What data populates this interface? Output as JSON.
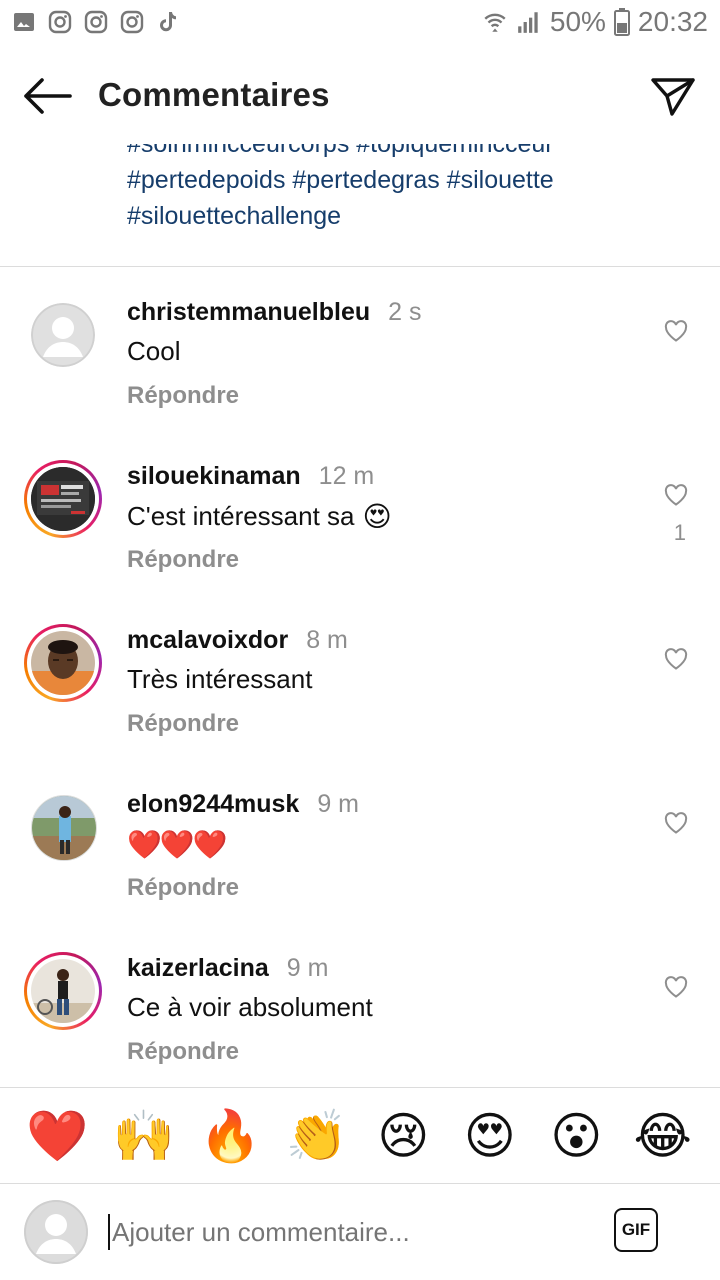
{
  "status_bar": {
    "battery": "50%",
    "time": "20:32",
    "left_icons": [
      "gallery-icon",
      "instagram-icon",
      "instagram-icon",
      "instagram-icon",
      "tiktok-icon"
    ],
    "right_icons": [
      "wifi-icon",
      "signal-icon",
      "battery-icon"
    ]
  },
  "header": {
    "title": "Commentaires",
    "back_icon": "back-arrow-icon",
    "share_icon": "send-icon"
  },
  "caption": {
    "line0": "#soinmincceurcorps #topiquemincceur",
    "line1": "#pertedepoids #pertedegras #silouette",
    "line2": "#silouettechallenge"
  },
  "comments": [
    {
      "username": "christemmanuelbleu",
      "time": "2 s",
      "text": "Cool",
      "emoji": "",
      "reply": "Répondre",
      "likes": ""
    },
    {
      "username": "silouekinaman",
      "time": "12 m",
      "text": "C'est intéressant sa",
      "emoji": "😍",
      "reply": "Répondre",
      "likes": "1"
    },
    {
      "username": "mcalavoixdor",
      "time": "8 m",
      "text": "Très intéressant",
      "emoji": "",
      "reply": "Répondre",
      "likes": ""
    },
    {
      "username": "elon9244musk",
      "time": "9 m",
      "text": "",
      "emoji": "❤️❤️❤️",
      "reply": "Répondre",
      "likes": ""
    },
    {
      "username": "kaizerlacina",
      "time": "9 m",
      "text": "Ce à voir absolument",
      "emoji": "",
      "reply": "Répondre",
      "likes": ""
    }
  ],
  "quick_emojis": [
    "❤️",
    "🙌",
    "🔥",
    "👏",
    "😢",
    "😍",
    "😮",
    "😂"
  ],
  "composer": {
    "placeholder": "Ajouter un commentaire...",
    "gif_label": "GIF"
  },
  "colors": {
    "hashtag": "#163d6b",
    "secondary_text": "#8e8e8e",
    "divider": "#dcdcdc"
  }
}
